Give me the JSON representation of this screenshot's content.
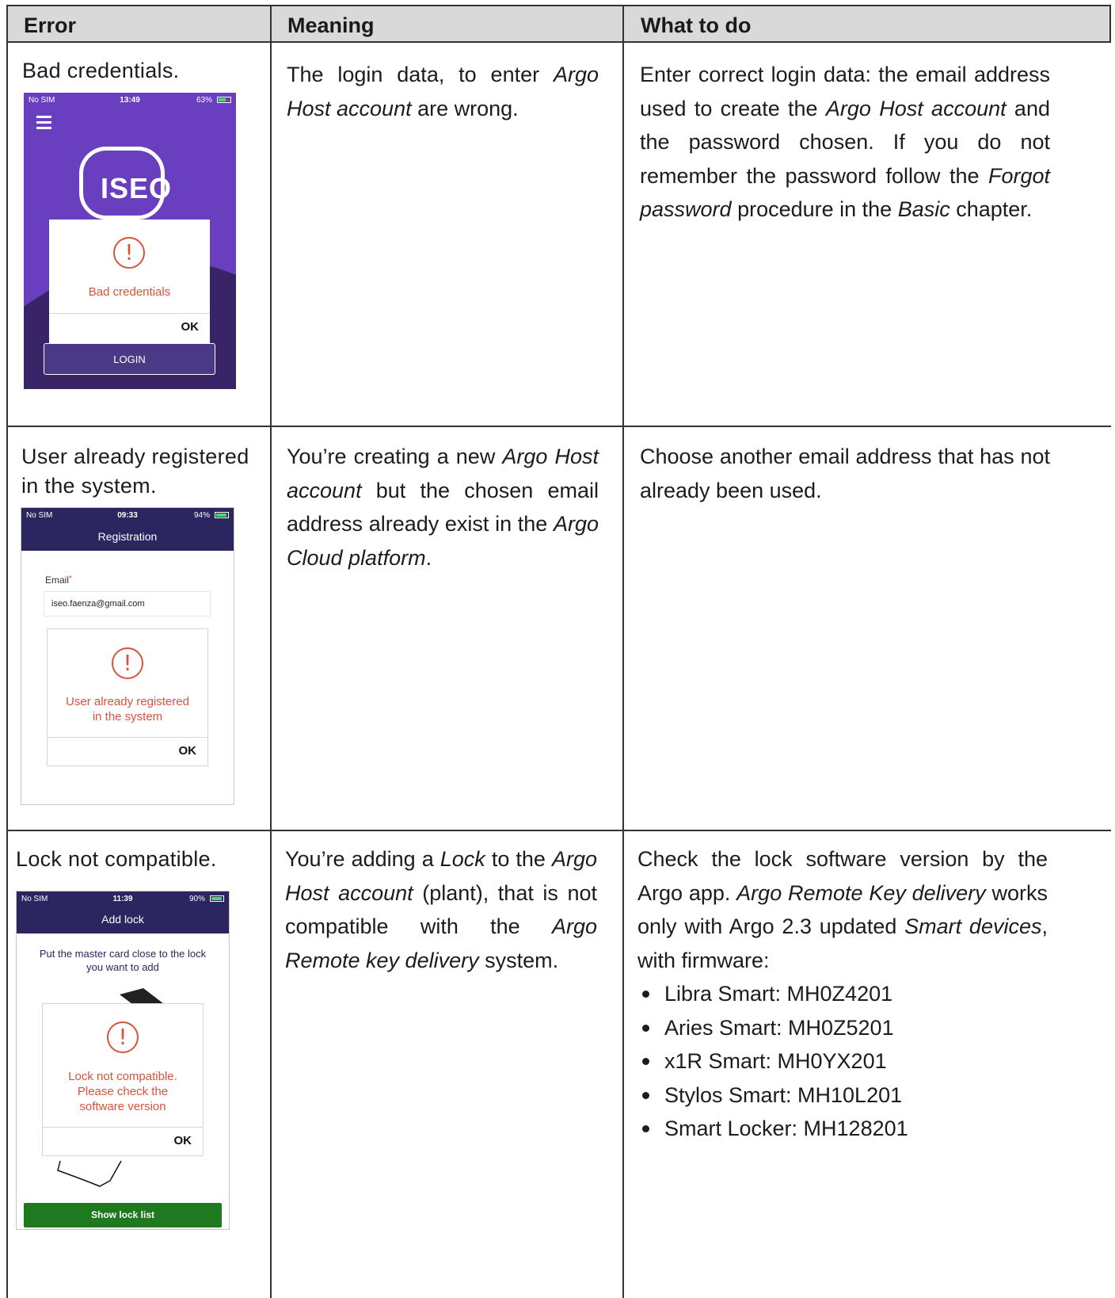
{
  "headers": {
    "error": "Error",
    "meaning": "Meaning",
    "what": "What to do"
  },
  "rows": [
    {
      "error": "Bad credentials.",
      "meaning": [
        "The login data, to enter ",
        "Argo Host account",
        " are wrong."
      ],
      "what": [
        "Enter correct login data: the email address used to create the ",
        "Argo Host account",
        " and the password chosen. If you do not remember the password follow the ",
        "Forgot password",
        " procedure in the ",
        "Basic",
        " chapter."
      ],
      "phone": {
        "carrier": "No SIM",
        "time": "13:49",
        "battery": "63%",
        "logo": "ISEO",
        "message": "Bad credentials",
        "ok": "OK",
        "button": "LOGIN",
        "battery_level": 0.63,
        "accent": "#6a3fbf"
      }
    },
    {
      "error": "User already registered in the system.",
      "meaning": [
        "You’re creating a new ",
        "Argo Host account",
        " but the chosen email address already exist in the ",
        "Argo Cloud platform",
        "."
      ],
      "what": [
        "Choose another email address that has not already been used."
      ],
      "phone": {
        "carrier": "No SIM",
        "time": "09:33",
        "battery": "94%",
        "title": "Registration",
        "email_label": "Email",
        "email_value": "iseo.faenza@gmail.com",
        "message_line1": "User already registered",
        "message_line2": "in the system",
        "ok": "OK",
        "battery_level": 0.94
      }
    },
    {
      "error": "Lock not compatible.",
      "meaning": [
        "You’re adding a ",
        "Lock",
        " to the ",
        "Argo Host account",
        " (plant), that is not compatible with the ",
        "Argo Remote key delivery",
        " system."
      ],
      "what": [
        "Check the lock software version by the Argo app. ",
        "Argo Remote Key delivery",
        " works only with Argo 2.3 updated ",
        "Smart devices",
        ", with firmware:"
      ],
      "firmware": [
        "Libra Smart: MH0Z4201",
        "Aries Smart: MH0Z5201",
        "x1R Smart: MH0YX201",
        "Stylos Smart: MH10L201",
        "Smart Locker: MH128201"
      ],
      "phone": {
        "carrier": "No SIM",
        "time": "11:39",
        "battery": "90%",
        "title": "Add lock",
        "instruction_line1": "Put the master card close to the lock",
        "instruction_line2": "you want to add",
        "message_line1": "Lock not compatible.",
        "message_line2": "Please check the",
        "message_line3": "software version",
        "ok": "OK",
        "button": "Show lock list",
        "battery_level": 0.9,
        "button_color": "#1f7a1f"
      }
    }
  ]
}
